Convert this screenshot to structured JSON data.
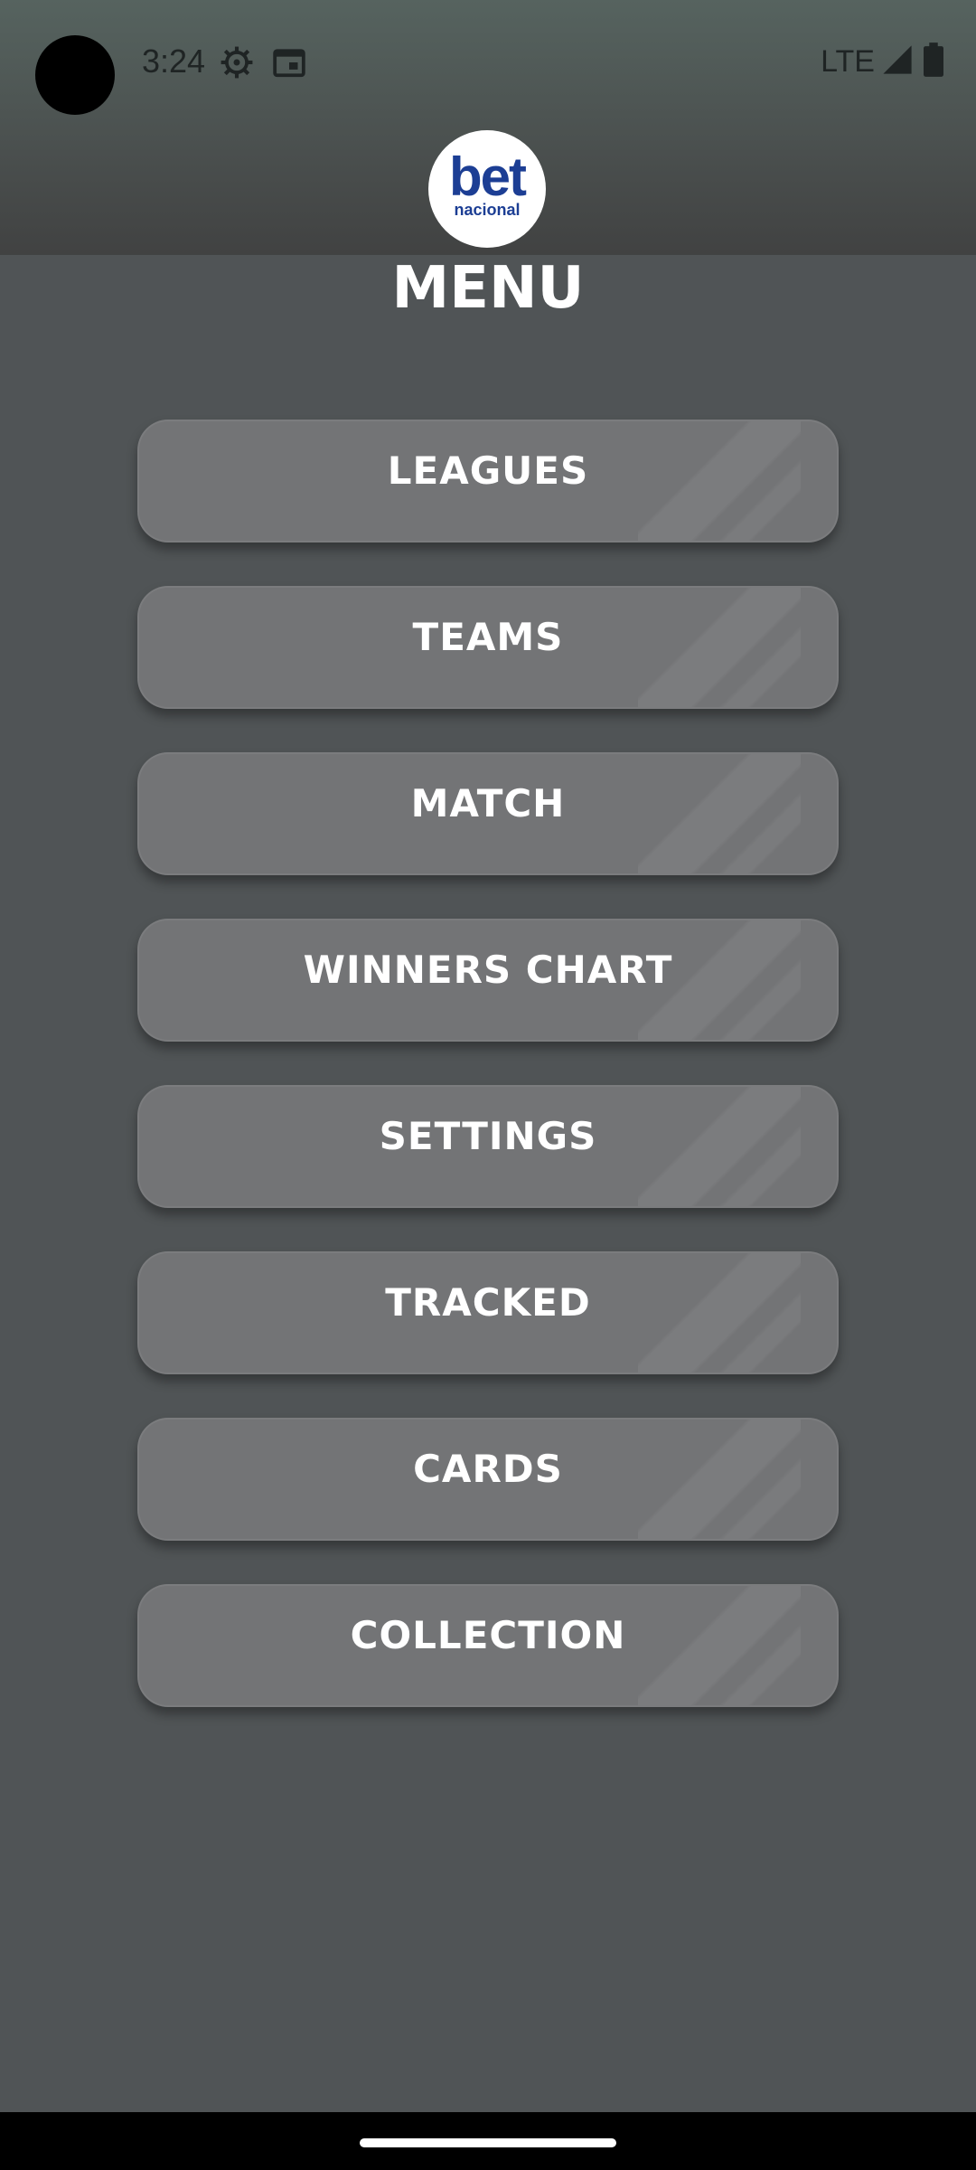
{
  "status_bar": {
    "time": "3:24",
    "network": "LTE",
    "icons": [
      "settings-gear-icon",
      "calendar-icon",
      "signal-icon",
      "battery-icon"
    ]
  },
  "logo": {
    "text": "bet",
    "subtext": "nacional"
  },
  "menu": {
    "title": "MENU",
    "items": [
      {
        "label": "LEAGUES"
      },
      {
        "label": "TEAMS"
      },
      {
        "label": "MATCH"
      },
      {
        "label": "WINNERS CHART"
      },
      {
        "label": "SETTINGS"
      },
      {
        "label": "TRACKED"
      },
      {
        "label": "CARDS"
      },
      {
        "label": "COLLECTION"
      }
    ]
  },
  "colors": {
    "background": "#505456",
    "button": "#737476",
    "logo_blue": "#1c3e94"
  }
}
